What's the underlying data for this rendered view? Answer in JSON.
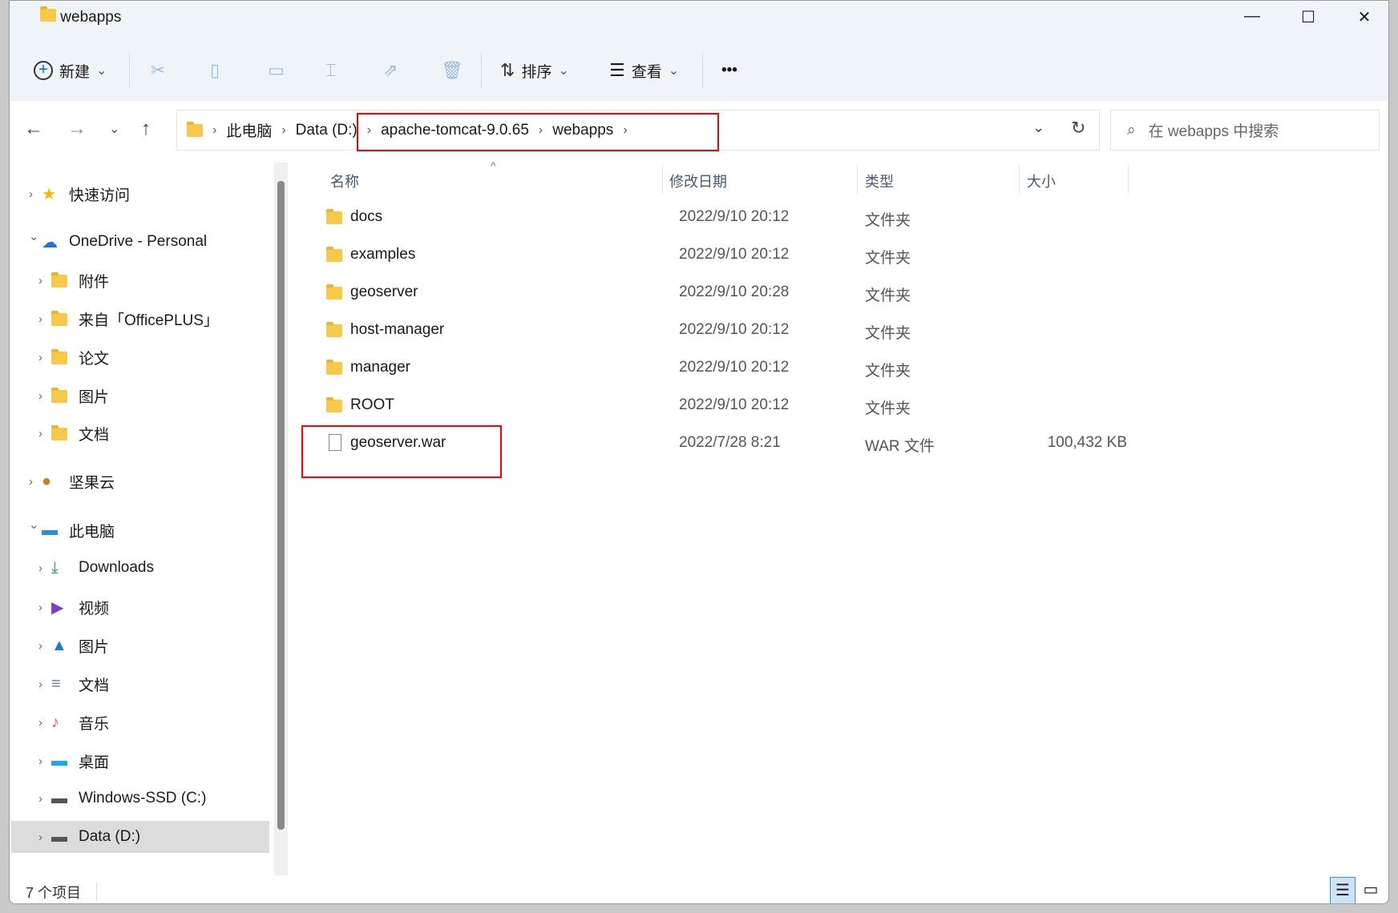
{
  "window": {
    "title": "webapps",
    "minimize": "—",
    "maximize": "☐",
    "close": "✕"
  },
  "toolbar": {
    "new_label": "新建",
    "sort_label": "排序",
    "view_label": "查看",
    "more": "•••",
    "icons": [
      "scissors-icon",
      "copy-icon",
      "paste-icon",
      "rename-icon",
      "share-icon",
      "trash-icon"
    ]
  },
  "address": {
    "crumbs": [
      "此电脑",
      "Data (D:)",
      "apache-tomcat-9.0.65",
      "webapps"
    ],
    "search_placeholder": "在 webapps 中搜索"
  },
  "sidebar": {
    "items": [
      {
        "label": "快速访问",
        "level": 0,
        "expanded": false,
        "icon": "star-icon"
      },
      {
        "label": "OneDrive - Personal",
        "level": 0,
        "expanded": true,
        "icon": "cloud-icon"
      },
      {
        "label": "附件",
        "level": 1,
        "icon": "folder-icon"
      },
      {
        "label": "来自「OfficePLUS」",
        "level": 1,
        "icon": "folder-icon"
      },
      {
        "label": "论文",
        "level": 1,
        "icon": "folder-icon"
      },
      {
        "label": "图片",
        "level": 1,
        "icon": "folder-icon"
      },
      {
        "label": "文档",
        "level": 1,
        "icon": "folder-icon"
      },
      {
        "label": "坚果云",
        "level": 0,
        "expanded": false,
        "icon": "nut-icon"
      },
      {
        "label": "此电脑",
        "level": 0,
        "expanded": true,
        "icon": "computer-icon"
      },
      {
        "label": "Downloads",
        "level": 1,
        "icon": "download-icon"
      },
      {
        "label": "视频",
        "level": 1,
        "icon": "video-icon"
      },
      {
        "label": "图片",
        "level": 1,
        "icon": "picture-icon"
      },
      {
        "label": "文档",
        "level": 1,
        "icon": "document-icon"
      },
      {
        "label": "音乐",
        "level": 1,
        "icon": "music-icon"
      },
      {
        "label": "桌面",
        "level": 1,
        "icon": "desktop-icon"
      },
      {
        "label": "Windows-SSD (C:)",
        "level": 1,
        "icon": "drive-icon"
      },
      {
        "label": "Data (D:)",
        "level": 1,
        "icon": "drive-icon",
        "selected": true
      }
    ]
  },
  "columns": {
    "name": "名称",
    "date": "修改日期",
    "type": "类型",
    "size": "大小"
  },
  "files": [
    {
      "name": "docs",
      "date": "2022/9/10 20:12",
      "type": "文件夹",
      "size": "",
      "icon": "folder-icon"
    },
    {
      "name": "examples",
      "date": "2022/9/10 20:12",
      "type": "文件夹",
      "size": "",
      "icon": "folder-icon"
    },
    {
      "name": "geoserver",
      "date": "2022/9/10 20:28",
      "type": "文件夹",
      "size": "",
      "icon": "folder-icon"
    },
    {
      "name": "host-manager",
      "date": "2022/9/10 20:12",
      "type": "文件夹",
      "size": "",
      "icon": "folder-icon"
    },
    {
      "name": "manager",
      "date": "2022/9/10 20:12",
      "type": "文件夹",
      "size": "",
      "icon": "folder-icon"
    },
    {
      "name": "ROOT",
      "date": "2022/9/10 20:12",
      "type": "文件夹",
      "size": "",
      "icon": "folder-icon"
    },
    {
      "name": "geoserver.war",
      "date": "2022/7/28 8:21",
      "type": "WAR 文件",
      "size": "100,432 KB",
      "icon": "file-icon"
    }
  ],
  "status": {
    "count": "7 个项目"
  },
  "colors": {
    "highlight": "#ff0000",
    "accent": "#0067c0"
  }
}
